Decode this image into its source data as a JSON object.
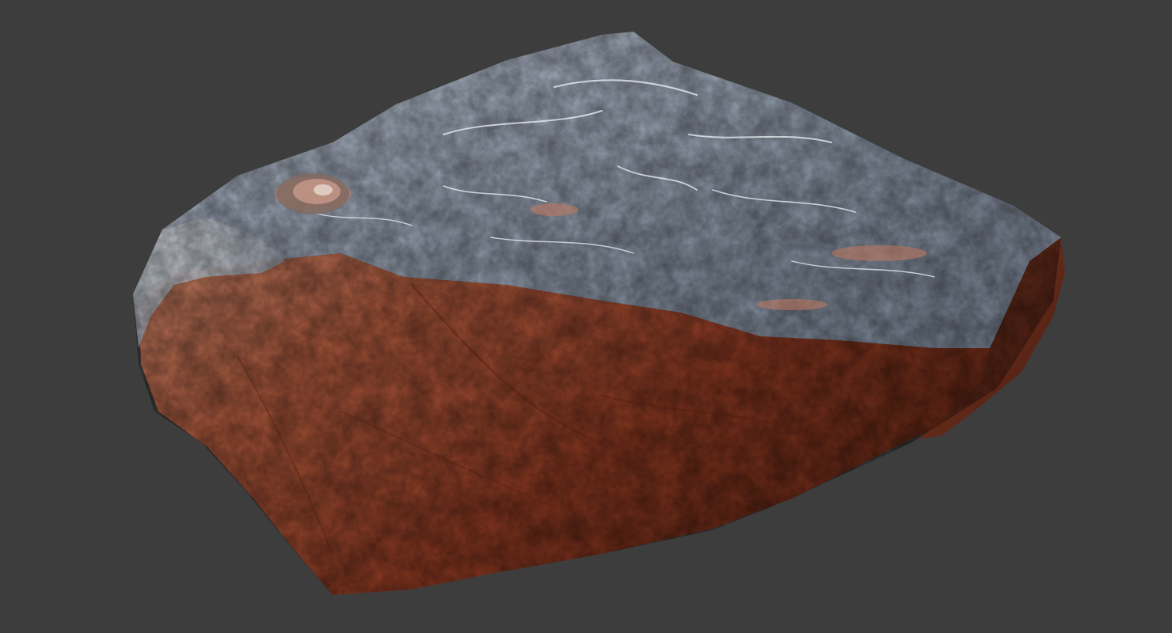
{
  "scene": {
    "background_color": "#3d3d3d",
    "subject": "rock",
    "materials": {
      "top_face": "#9aa6b8",
      "top_highlight": "#e6edf6",
      "side_face": "#a04a30",
      "side_shadow": "#5e2414",
      "side_highlight": "#cf7d5e"
    }
  }
}
